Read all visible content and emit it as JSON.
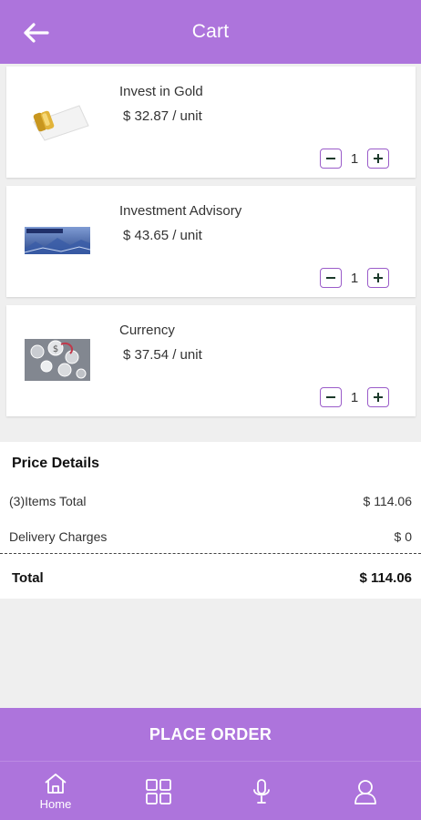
{
  "header": {
    "title": "Cart",
    "back_icon": "arrow-left-icon",
    "background": "#ad74dc"
  },
  "cart": {
    "items": [
      {
        "name": "Invest in Gold",
        "price": "$  32.87 / unit",
        "quantity": "1",
        "thumbnail_icon": "gold-bar-thumbnail"
      },
      {
        "name": "Investment Advisory",
        "price": "$  43.65 / unit",
        "quantity": "1",
        "thumbnail_icon": "advisory-banner-thumbnail"
      },
      {
        "name": "Currency",
        "price": "$  37.54 / unit",
        "quantity": "1",
        "thumbnail_icon": "currency-thumbnail"
      }
    ]
  },
  "price_details": {
    "title": "Price Details",
    "items_total_label": "(3)Items Total",
    "items_total_value": "$  114.06",
    "delivery_label": "Delivery Charges",
    "delivery_value": "$  0",
    "total_label": "Total",
    "total_value": "$  114.06"
  },
  "actions": {
    "place_order": "PLACE ORDER"
  },
  "bottom_nav": {
    "items": [
      {
        "label": "Home",
        "icon": "home-icon"
      },
      {
        "label": "",
        "icon": "grid-icon"
      },
      {
        "label": "",
        "icon": "microphone-icon"
      },
      {
        "label": "",
        "icon": "user-icon"
      }
    ]
  },
  "colors": {
    "accent": "#ad74dc",
    "button_border": "#9a5cc9",
    "background": "#efefef"
  }
}
